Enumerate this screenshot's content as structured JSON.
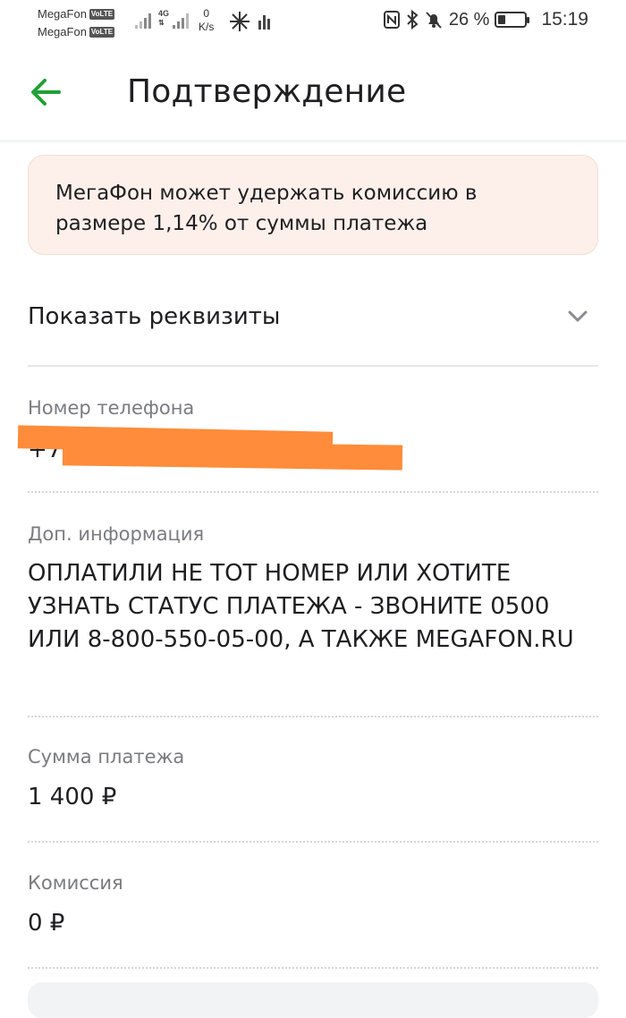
{
  "status_bar": {
    "sim1": "MegaFon",
    "sim2": "MegaFon",
    "volte": "VoLTE",
    "network_type": "4G",
    "speed_value": "0",
    "speed_unit": "K/s",
    "battery_percent": "26 %",
    "battery_level": 0.26,
    "time": "15:19"
  },
  "app_bar": {
    "title": "Подтверждение",
    "accent_color": "#21a038",
    "back_icon": "arrow-left-icon"
  },
  "notice": {
    "text": "МегаФон может удержать комиссию в размере 1,14% от суммы платежа",
    "background": "#fdf0ea"
  },
  "details_toggle": {
    "label": "Показать реквизиты",
    "icon": "chevron-down-icon"
  },
  "fields": {
    "phone": {
      "label": "Номер телефона",
      "value": "+7"
    },
    "extra": {
      "label": "Доп. информация",
      "value": "ОПЛАТИЛИ НЕ ТОТ НОМЕР ИЛИ ХОТИТЕ УЗНАТЬ СТАТУС ПЛАТЕЖА - ЗВОНИТЕ 0500 ИЛИ 8-800-550-05-00, А ТАКЖЕ MEGAFON.RU"
    },
    "amount": {
      "label": "Сумма платежа",
      "value": "1 400 ₽"
    },
    "commission": {
      "label": "Комиссия",
      "value": "0 ₽"
    }
  },
  "redaction_color": "#ff8c3a"
}
